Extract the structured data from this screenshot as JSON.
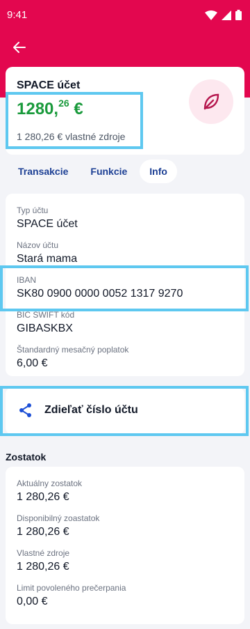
{
  "status_bar": {
    "time": "9:41"
  },
  "colors": {
    "brand": "#e3074f",
    "amount_green": "#1a9a3c",
    "tab_blue": "#1c3f94",
    "highlight": "#5ec8f0"
  },
  "account": {
    "name": "SPACE účet",
    "amount_main": "1280,",
    "amount_decimals": "26",
    "currency": "€",
    "own_funds": "1 280,26 € vlastné zdroje",
    "icon": "leaf-icon"
  },
  "tabs": [
    {
      "label": "Transakcie",
      "active": false
    },
    {
      "label": "Funkcie",
      "active": false
    },
    {
      "label": "Info",
      "active": true
    }
  ],
  "info": {
    "fields": [
      {
        "label": "Typ účtu",
        "value": "SPACE účet"
      },
      {
        "label": "Názov účtu",
        "value": "Stará mama"
      },
      {
        "label": "IBAN",
        "value": "SK80 0900 0000 0052 1317 9270"
      },
      {
        "label": "BIC SWIFT kód",
        "value": "GIBASKBX"
      },
      {
        "label": "Štandardný mesačný poplatok",
        "value": "6,00 €"
      }
    ]
  },
  "share": {
    "label": "Zdieľať číslo účtu",
    "icon": "share-icon"
  },
  "balance": {
    "title": "Zostatok",
    "fields": [
      {
        "label": "Aktuálny zostatok",
        "value": "1 280,26 €"
      },
      {
        "label": "Disponibilný zoastatok",
        "value": "1 280,26 €"
      },
      {
        "label": "Vlastné zdroje",
        "value": "1 280,26 €"
      },
      {
        "label": "Limit povoleného prečerpania",
        "value": "0,00 €"
      }
    ]
  }
}
